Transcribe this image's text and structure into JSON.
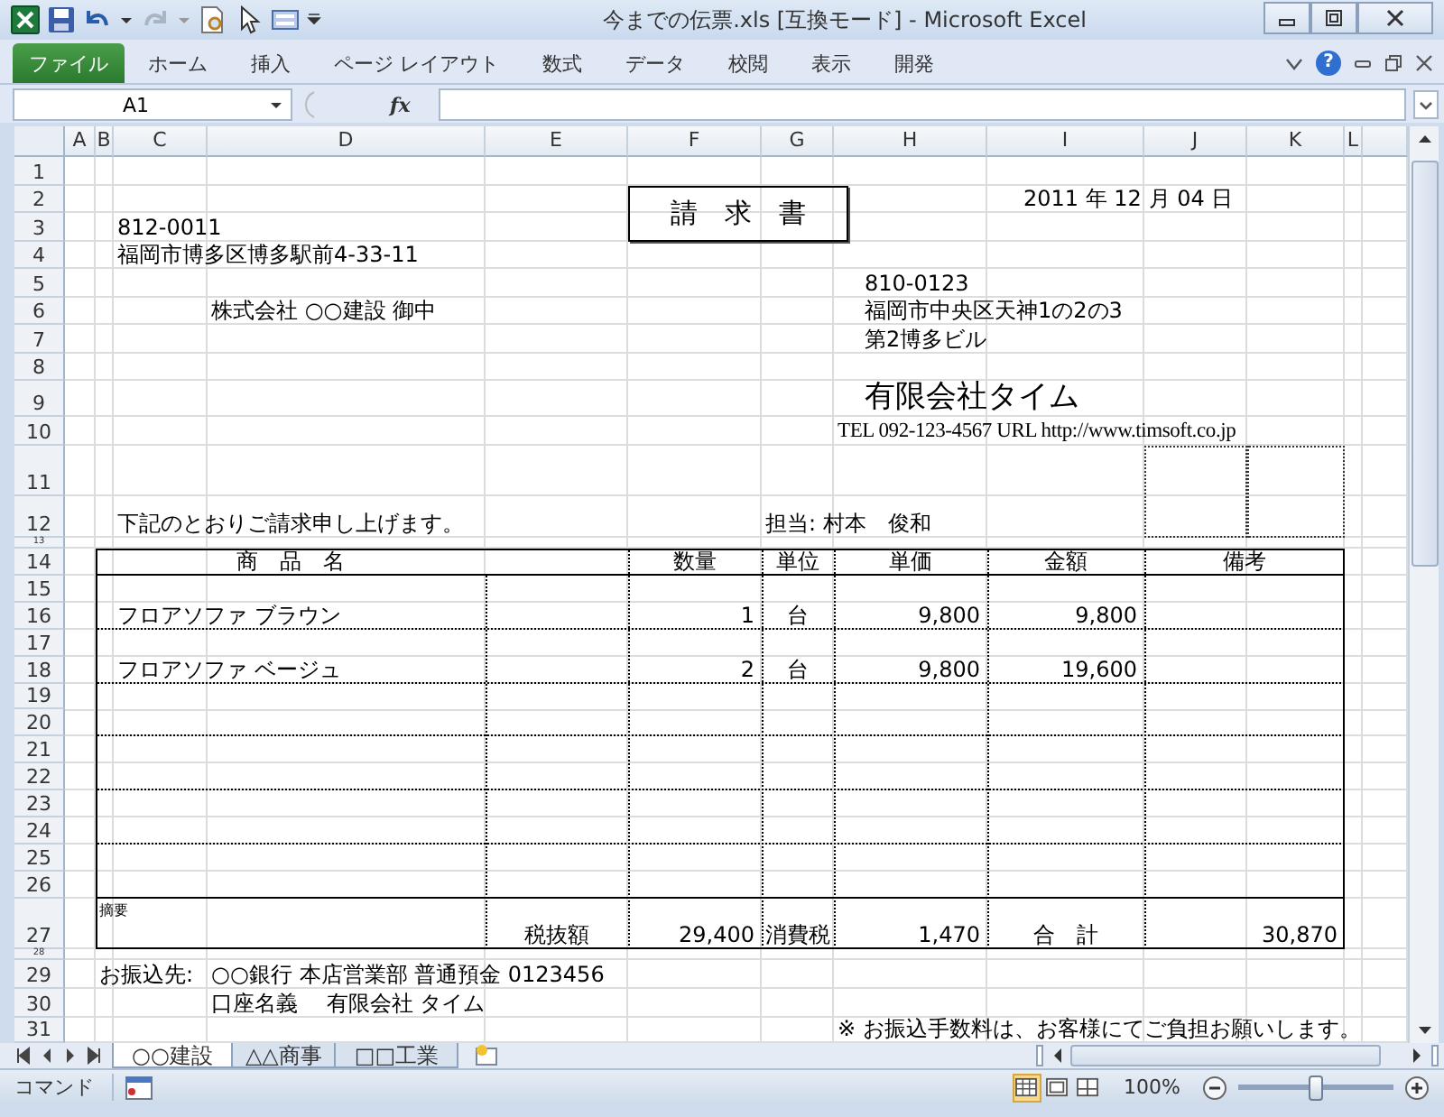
{
  "window": {
    "title": "今までの伝票.xls  [互換モード] - Microsoft Excel"
  },
  "ribbon": {
    "tabs": [
      {
        "label": "ファイル",
        "kind": "file"
      },
      {
        "label": "ホーム",
        "kind": "tab"
      },
      {
        "label": "挿入",
        "kind": "tab"
      },
      {
        "label": "ページ レイアウト",
        "kind": "tab"
      },
      {
        "label": "数式",
        "kind": "tab"
      },
      {
        "label": "データ",
        "kind": "tab"
      },
      {
        "label": "校閲",
        "kind": "tab"
      },
      {
        "label": "表示",
        "kind": "tab"
      },
      {
        "label": "開発",
        "kind": "tab"
      }
    ],
    "help": "?"
  },
  "formula_bar": {
    "name_box": "A1",
    "function_label": "fx"
  },
  "sheet": {
    "columns": [
      "A",
      "B",
      "C",
      "D",
      "E",
      "F",
      "G",
      "H",
      "I",
      "J",
      "K",
      "L"
    ],
    "rows": [
      {
        "number": "1",
        "cells": [
          "",
          "",
          "",
          "",
          "",
          "",
          "",
          "",
          "",
          "",
          "",
          ""
        ]
      },
      {
        "number": "2",
        "cells": [
          "",
          "",
          "",
          "",
          "",
          {
            "text": "請　求　書",
            "kind": "title"
          },
          "",
          "",
          {
            "text": "2011 年 12 月 04 日",
            "kind": "date"
          },
          "",
          "",
          ""
        ]
      },
      {
        "number": "3",
        "cells": [
          "",
          "",
          {
            "text": "812-0011",
            "kind": "text"
          },
          "",
          "",
          "",
          "",
          "",
          "",
          "",
          "",
          ""
        ]
      },
      {
        "number": "4",
        "cells": [
          "",
          "",
          {
            "text": "福岡市博多区博多駅前4-33-11",
            "kind": "text"
          },
          "",
          "",
          "",
          "",
          "",
          "",
          "",
          "",
          ""
        ]
      },
      {
        "number": "5",
        "cells": [
          "",
          "",
          "",
          "",
          "",
          "",
          "",
          {
            "text": "810-0123",
            "kind": "indented"
          },
          "",
          "",
          "",
          ""
        ]
      },
      {
        "number": "6",
        "cells": [
          "",
          "",
          "",
          {
            "text": "株式会社 ○○建設 御中",
            "kind": "text"
          },
          "",
          "",
          "",
          {
            "text": "福岡市中央区天神1の2の3",
            "kind": "indented"
          },
          "",
          "",
          "",
          ""
        ]
      },
      {
        "number": "7",
        "cells": [
          "",
          "",
          "",
          "",
          "",
          "",
          "",
          {
            "text": "第2博多ビル",
            "kind": "indented"
          },
          "",
          "",
          "",
          ""
        ]
      },
      {
        "number": "8",
        "cells": [
          "",
          "",
          "",
          "",
          "",
          "",
          "",
          "",
          "",
          "",
          "",
          ""
        ]
      },
      {
        "number": "9",
        "cells": [
          "",
          "",
          "",
          "",
          "",
          "",
          "",
          {
            "text": "有限会社タイム",
            "kind": "company"
          },
          "",
          "",
          "",
          ""
        ]
      },
      {
        "number": "10",
        "cells": [
          "",
          "",
          "",
          "",
          "",
          "",
          "",
          {
            "text": "TEL 092-123-4567 URL http://www.timsoft.co.jp",
            "kind": "contact"
          },
          "",
          "",
          "",
          ""
        ]
      },
      {
        "number": "11",
        "cells": [
          "",
          "",
          "",
          "",
          "",
          "",
          "",
          "",
          "",
          "",
          "",
          ""
        ]
      },
      {
        "number": "12",
        "cells": [
          "",
          "",
          {
            "text": "下記のとおりご請求申し上げます。",
            "kind": "text"
          },
          "",
          "",
          "",
          {
            "text": "担当: 村本　俊和",
            "kind": "text"
          },
          "",
          "",
          "",
          "",
          ""
        ]
      },
      {
        "number": "13",
        "cells": [
          "",
          "",
          "",
          "",
          "",
          "",
          "",
          "",
          "",
          "",
          "",
          ""
        ]
      },
      {
        "number": "14",
        "cells": [
          "",
          "",
          "",
          {
            "text": "商　品　名",
            "kind": "heading"
          },
          "",
          {
            "text": "数量",
            "kind": "heading"
          },
          {
            "text": "単位",
            "kind": "heading"
          },
          {
            "text": "単価",
            "kind": "heading"
          },
          {
            "text": "金額",
            "kind": "heading"
          },
          {
            "text": "備考",
            "kind": "heading"
          },
          "",
          ""
        ]
      },
      {
        "number": "15",
        "cells": [
          "",
          "",
          "",
          "",
          "",
          "",
          "",
          "",
          "",
          "",
          "",
          ""
        ]
      },
      {
        "number": "16",
        "cells": [
          "",
          "",
          {
            "text": "フロアソファ ブラウン",
            "kind": "text"
          },
          "",
          "",
          {
            "text": "1",
            "kind": "number"
          },
          {
            "text": "台",
            "kind": "label"
          },
          {
            "text": "9,800",
            "kind": "number"
          },
          {
            "text": "9,800",
            "kind": "number"
          },
          "",
          "",
          ""
        ]
      },
      {
        "number": "17",
        "cells": [
          "",
          "",
          "",
          "",
          "",
          "",
          "",
          "",
          "",
          "",
          "",
          ""
        ]
      },
      {
        "number": "18",
        "cells": [
          "",
          "",
          {
            "text": "フロアソファ ベージュ",
            "kind": "text"
          },
          "",
          "",
          {
            "text": "2",
            "kind": "number"
          },
          {
            "text": "台",
            "kind": "label"
          },
          {
            "text": "9,800",
            "kind": "number"
          },
          {
            "text": "19,600",
            "kind": "number"
          },
          "",
          "",
          ""
        ]
      },
      {
        "number": "19",
        "cells": [
          "",
          "",
          "",
          "",
          "",
          "",
          "",
          "",
          "",
          "",
          "",
          ""
        ]
      },
      {
        "number": "20",
        "cells": [
          "",
          "",
          "",
          "",
          "",
          "",
          "",
          "",
          "",
          "",
          "",
          ""
        ]
      },
      {
        "number": "21",
        "cells": [
          "",
          "",
          "",
          "",
          "",
          "",
          "",
          "",
          "",
          "",
          "",
          ""
        ]
      },
      {
        "number": "22",
        "cells": [
          "",
          "",
          "",
          "",
          "",
          "",
          "",
          "",
          "",
          "",
          "",
          ""
        ]
      },
      {
        "number": "23",
        "cells": [
          "",
          "",
          "",
          "",
          "",
          "",
          "",
          "",
          "",
          "",
          "",
          ""
        ]
      },
      {
        "number": "24",
        "cells": [
          "",
          "",
          "",
          "",
          "",
          "",
          "",
          "",
          "",
          "",
          "",
          ""
        ]
      },
      {
        "number": "25",
        "cells": [
          "",
          "",
          "",
          "",
          "",
          "",
          "",
          "",
          "",
          "",
          "",
          ""
        ]
      },
      {
        "number": "26",
        "cells": [
          "",
          "",
          "",
          "",
          "",
          "",
          "",
          "",
          "",
          "",
          "",
          ""
        ]
      },
      {
        "number": "27",
        "cells": [
          "",
          {
            "text": "摘要",
            "kind": "note"
          },
          "",
          "",
          {
            "text": "税抜額",
            "kind": "label"
          },
          {
            "text": "29,400",
            "kind": "number"
          },
          {
            "text": "消費税",
            "kind": "label"
          },
          {
            "text": "1,470",
            "kind": "number"
          },
          {
            "text": "合　計",
            "kind": "label"
          },
          "",
          {
            "text": "30,870",
            "kind": "number"
          },
          ""
        ]
      },
      {
        "number": "28",
        "cells": [
          "",
          "",
          "",
          "",
          "",
          "",
          "",
          "",
          "",
          "",
          "",
          ""
        ]
      },
      {
        "number": "29",
        "cells": [
          "",
          {
            "text": "お振込先:",
            "kind": "text"
          },
          "",
          {
            "text": "○○銀行  本店営業部  普通預金 0123456",
            "kind": "text"
          },
          "",
          "",
          "",
          "",
          "",
          "",
          "",
          ""
        ]
      },
      {
        "number": "30",
        "cells": [
          "",
          "",
          "",
          {
            "text": "口座名義　 有限会社 タイム",
            "kind": "text"
          },
          "",
          "",
          "",
          "",
          "",
          "",
          "",
          ""
        ]
      },
      {
        "number": "31",
        "cells": [
          "",
          "",
          "",
          "",
          "",
          "",
          "",
          {
            "text": "※  お振込手数料は、お客様にてご負担お願いします。",
            "kind": "text"
          },
          "",
          "",
          "",
          ""
        ]
      }
    ]
  },
  "sheet_tabs": [
    {
      "label": "○○建設",
      "selected": true
    },
    {
      "label": "△△商事",
      "selected": false
    },
    {
      "label": "□□工業",
      "selected": false
    }
  ],
  "status_bar": {
    "mode": "コマンド",
    "view_buttons": [
      {
        "kind": "normal",
        "selected": true
      },
      {
        "kind": "layout",
        "selected": false
      },
      {
        "kind": "pagebreak",
        "selected": false
      }
    ],
    "zoom": "100%",
    "zoom_slider": {
      "level": 0.5
    }
  }
}
